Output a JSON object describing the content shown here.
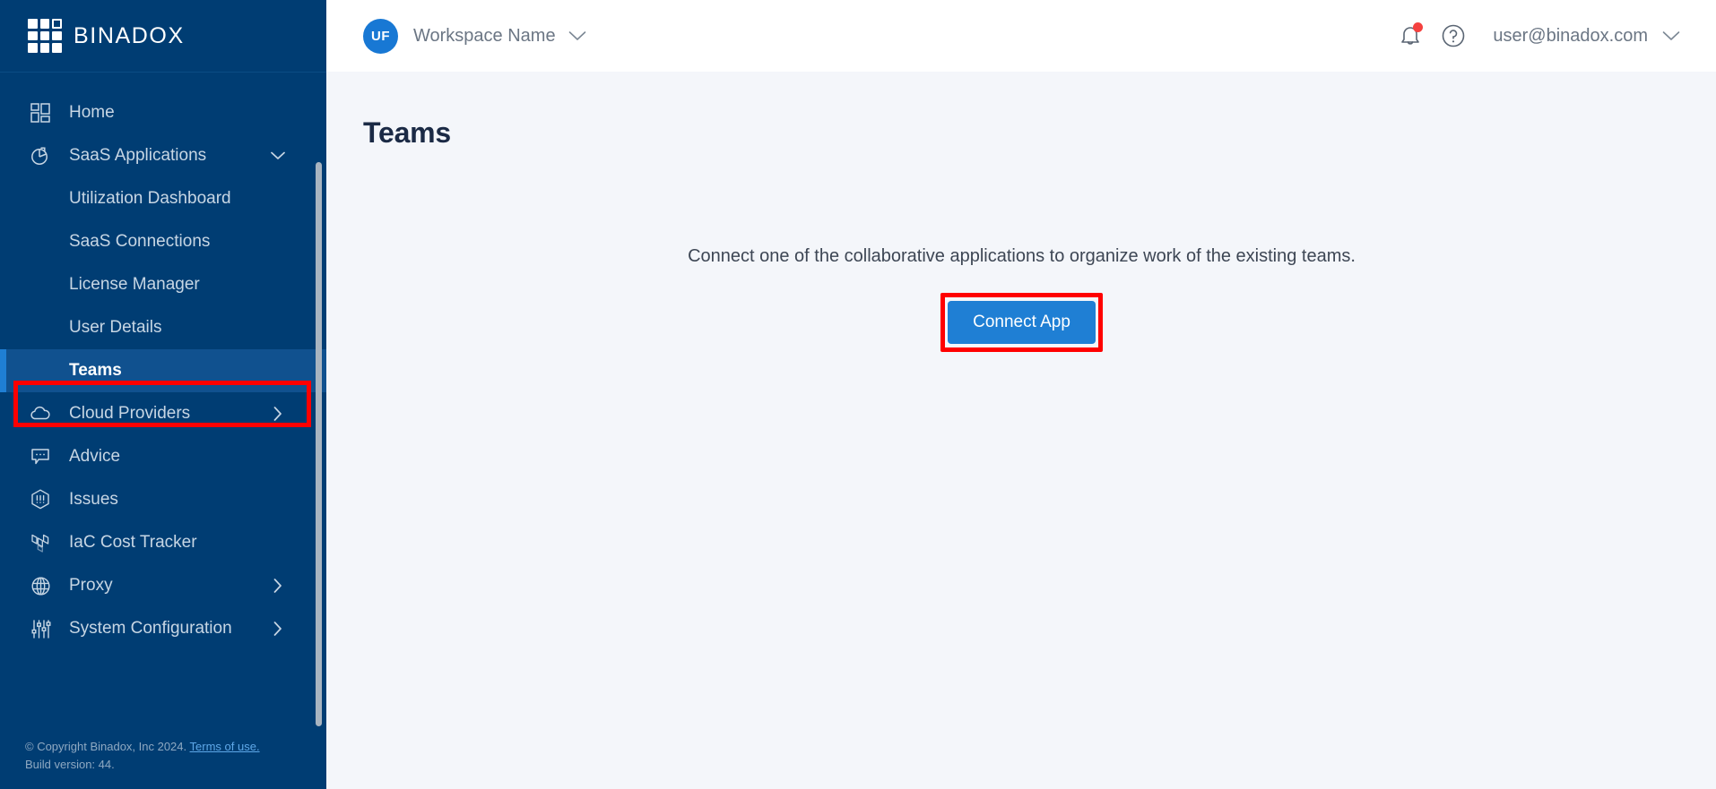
{
  "brand": {
    "logo_text": "BINADOX",
    "logo_icon": "binadox-grid-logo"
  },
  "topbar": {
    "workspace_initials": "UF",
    "workspace_name": "Workspace Name",
    "workspace_chevron_icon": "chevron-down-icon",
    "notifications_icon": "bell-icon",
    "notifications_has_alert": true,
    "help_icon": "help-circle-icon",
    "user_email": "user@binadox.com",
    "user_chevron_icon": "chevron-down-icon"
  },
  "sidebar": {
    "items": [
      {
        "label": "Home",
        "icon": "dashboard-grid-icon",
        "level": "top",
        "chevron": "",
        "active": false
      },
      {
        "label": "SaaS Applications",
        "icon": "pie-chart-icon",
        "level": "top",
        "chevron": "chevron-down-icon",
        "active": false
      },
      {
        "label": "Utilization Dashboard",
        "icon": "",
        "level": "sub",
        "chevron": "",
        "active": false
      },
      {
        "label": "SaaS Connections",
        "icon": "",
        "level": "sub",
        "chevron": "",
        "active": false
      },
      {
        "label": "License Manager",
        "icon": "",
        "level": "sub",
        "chevron": "",
        "active": false
      },
      {
        "label": "User Details",
        "icon": "",
        "level": "sub",
        "chevron": "",
        "active": false
      },
      {
        "label": "Teams",
        "icon": "",
        "level": "sub",
        "chevron": "",
        "active": true
      },
      {
        "label": "Cloud Providers",
        "icon": "cloud-icon",
        "level": "top",
        "chevron": "chevron-right-icon",
        "active": false
      },
      {
        "label": "Advice",
        "icon": "speech-bubble-icon",
        "level": "top",
        "chevron": "",
        "active": false
      },
      {
        "label": "Issues",
        "icon": "hexagon-alert-icon",
        "level": "top",
        "chevron": "",
        "active": false
      },
      {
        "label": "IaC Cost Tracker",
        "icon": "terraform-icon",
        "level": "top",
        "chevron": "",
        "active": false
      },
      {
        "label": "Proxy",
        "icon": "globe-icon",
        "level": "top",
        "chevron": "chevron-right-icon",
        "active": false
      },
      {
        "label": "System Configuration",
        "icon": "sliders-icon",
        "level": "top",
        "chevron": "chevron-right-icon",
        "active": false
      }
    ],
    "footer": {
      "copyright": "© Copyright Binadox, Inc 2024.",
      "terms_link": "Terms of use.",
      "build": "Build version: 44."
    }
  },
  "main": {
    "page_title": "Teams",
    "empty_message": "Connect one of the collaborative applications to organize work of the existing teams.",
    "connect_button_label": "Connect App"
  },
  "colors": {
    "sidebar_bg": "#003d73",
    "sidebar_active_bg": "#10518f",
    "accent_blue": "#1f7fd4",
    "avatar_blue": "#1878d4",
    "content_bg": "#f4f6fa",
    "annotation_red": "#ff0000",
    "alert_red": "#f5413f"
  }
}
